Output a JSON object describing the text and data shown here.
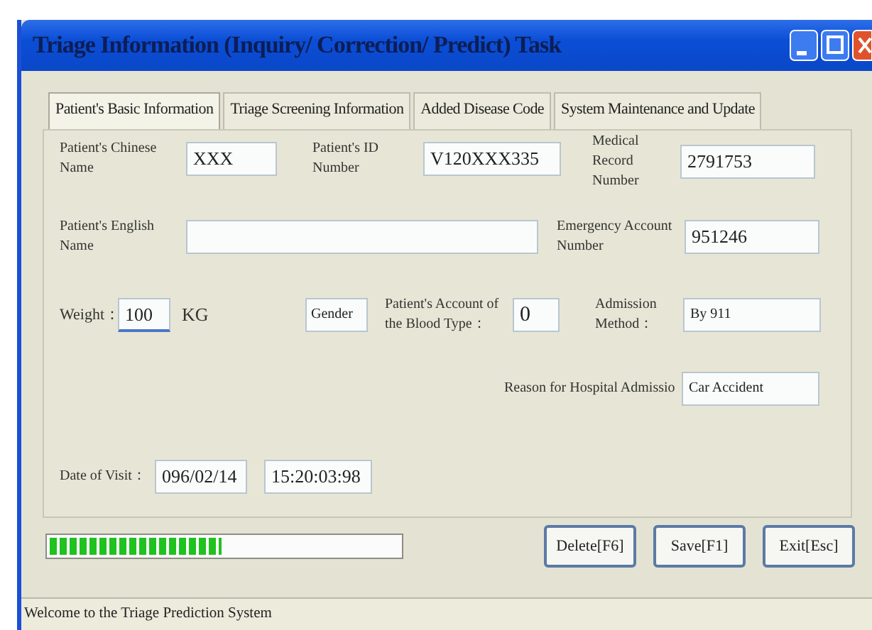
{
  "window": {
    "title": "Triage Information (Inquiry/ Correction/ Predict) Task"
  },
  "tabs": [
    {
      "label": "Patient's Basic Information",
      "selected": true
    },
    {
      "label": "Triage Screening Information",
      "selected": false
    },
    {
      "label": "Added Disease Code",
      "selected": false
    },
    {
      "label": "System Maintenance and Update",
      "selected": false
    }
  ],
  "form": {
    "fields": [
      {
        "label": "Patient's Chinese Name",
        "value": "XXX"
      },
      {
        "label": "Patient's ID Number",
        "value": "V120XXX335"
      },
      {
        "label": "Medical Record Number",
        "value": "2791753"
      },
      {
        "label": "Patient's English Name"
      },
      {
        "label": "Emergency Account Number",
        "value": "951246"
      },
      {
        "label": "Weight：",
        "value": "100",
        "unit": "KG",
        "focused": true
      },
      {
        "value": "Gender"
      },
      {
        "label": "Patient's Account of the Blood Type：",
        "value": "0"
      },
      {
        "label": "Admission Method：",
        "value": "By 911"
      },
      {
        "label": "Reason for Hospital Admissio",
        "value": "Car Accident"
      },
      {
        "label": "Date of Visit：",
        "value": "096/02/14"
      },
      {
        "value": "15:20:03:98"
      }
    ]
  },
  "progress": {
    "level": 0.49
  },
  "buttons": [
    "Delete[F6]",
    "Save[F1]",
    "Exit[Esc]"
  ],
  "status_bar": "Welcome to the Triage Prediction System"
}
